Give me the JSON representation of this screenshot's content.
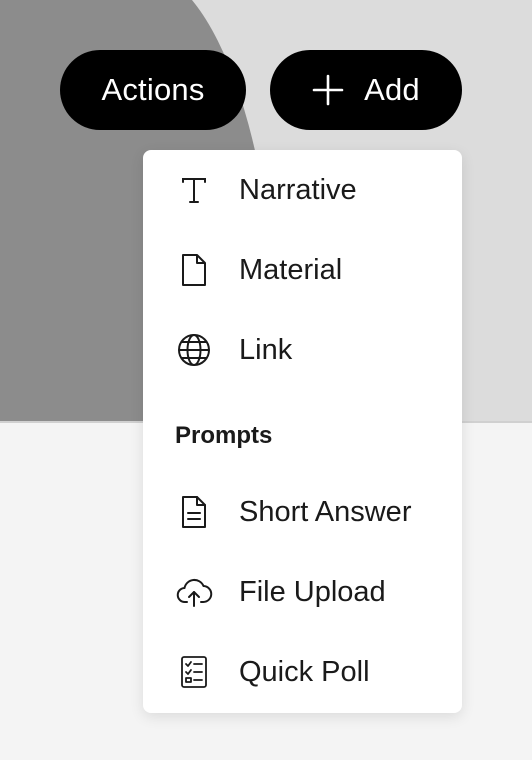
{
  "toolbar": {
    "actions_label": "Actions",
    "add_label": "Add"
  },
  "menu": {
    "items": [
      {
        "label": "Narrative",
        "icon": "text-type-icon"
      },
      {
        "label": "Material",
        "icon": "file-icon"
      },
      {
        "label": "Link",
        "icon": "globe-icon"
      }
    ],
    "prompts_title": "Prompts",
    "prompts": [
      {
        "label": "Short Answer",
        "icon": "document-lines-icon"
      },
      {
        "label": "File Upload",
        "icon": "cloud-upload-icon"
      },
      {
        "label": "Quick Poll",
        "icon": "checklist-icon"
      }
    ]
  },
  "colors": {
    "button_bg": "#000000",
    "button_text": "#ffffff",
    "menu_bg": "#ffffff",
    "text": "#1a1a1a"
  }
}
